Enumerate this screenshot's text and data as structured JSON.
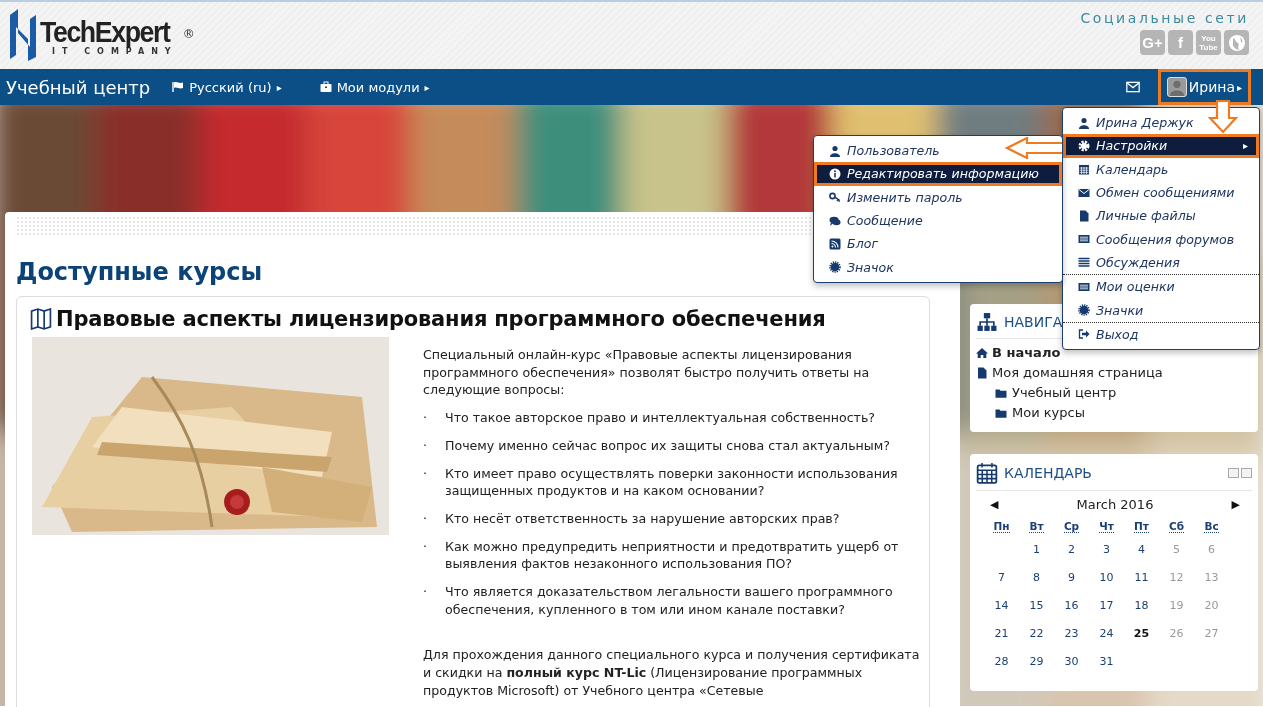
{
  "header": {
    "logo": {
      "name": "TechExpert",
      "mark": "®",
      "tagline": "IT COMPANY"
    },
    "social_title": "Социальные сети",
    "social": [
      {
        "kind": "text",
        "lines": [
          "G+"
        ]
      },
      {
        "kind": "text",
        "lines": [
          "f"
        ]
      },
      {
        "kind": "text",
        "lines": [
          "You",
          "Tube"
        ]
      },
      {
        "kind": "globe"
      }
    ]
  },
  "navbar": {
    "brand": "Учебный центр",
    "menus": [
      {
        "label": "Русский (ru)",
        "caret": "▸"
      },
      {
        "label": "Мои модули",
        "caret": "▸"
      }
    ],
    "user": {
      "name": "Ирина",
      "caret": "▸",
      "highlighted": true
    }
  },
  "user_menu": {
    "sections": [
      [
        {
          "label": "Ирина Держук",
          "selected": false
        },
        {
          "label": "Настройки",
          "selected": true,
          "submenu_caret": "▸"
        },
        {
          "label": "Календарь",
          "selected": false
        },
        {
          "label": "Обмен сообщениями",
          "selected": false
        },
        {
          "label": "Личные файлы",
          "selected": false
        },
        {
          "label": "Сообщения форумов",
          "selected": false
        },
        {
          "label": "Обсуждения",
          "selected": false
        }
      ],
      [
        {
          "label": "Мои оценки",
          "selected": false
        },
        {
          "label": "Значки",
          "selected": false
        }
      ],
      [
        {
          "label": "Выход",
          "selected": false
        }
      ]
    ]
  },
  "settings_submenu": [
    {
      "label": "Пользователь",
      "selected": false
    },
    {
      "label": "Редактировать информацию",
      "selected": true
    },
    {
      "label": "Изменить пароль",
      "selected": false
    },
    {
      "label": "Сообщение",
      "selected": false
    },
    {
      "label": "Блог",
      "selected": false
    },
    {
      "label": "Значок",
      "selected": false
    }
  ],
  "main": {
    "heading": "Доступные курсы",
    "course": {
      "title": "Правовые аспекты лицензирования программного обеспечения",
      "intro": "Специальный онлайн-курс «Правовые аспекты лицензирования программного обеспечения» позволят быстро получить ответы на следующие вопросы:",
      "questions": [
        {
          "marker": "·",
          "text": "Что такое авторское право и интеллектуальная собственность?"
        },
        {
          "marker": "·",
          "text": "Почему именно сейчас вопрос их защиты снова стал актуальным?"
        },
        {
          "marker": "·",
          "text": "Кто имеет право осуществлять поверки законности использования защищенных продуктов и на каком основании?"
        },
        {
          "marker": "·",
          "text": "Кто несёт ответственность за нарушение авторских прав?"
        },
        {
          "marker": "·",
          "text": "Как можно предупредить неприятности и предотвратить ущерб от выявления фактов незаконного использования ПО?"
        },
        {
          "marker": "·",
          "text": "Что является доказательством легальности вашего программного обеспечения, купленного в том или ином канале поставки?"
        }
      ],
      "outro": "Для прохождения данного специального курса и получения сертификата и скидки на **полный курс NT-Lic** (Лицензирование программных продуктов Microsoft) от Учебного центра «Сетевые"
    }
  },
  "navigation": {
    "title": "НАВИГА",
    "items": [
      {
        "label": "В начало",
        "bold": true
      },
      {
        "label": "Моя домашняя страница",
        "bold": false,
        "children": [
          {
            "label": "Учебный центр",
            "bold": false
          },
          {
            "label": "Мои курсы",
            "bold": false
          }
        ]
      }
    ]
  },
  "calendar": {
    "title": "КАЛЕНДАРЬ",
    "prev": "◀",
    "month": "March 2016",
    "next": "▶",
    "weekdays": [
      "Пн",
      "Вт",
      "Ср",
      "Чт",
      "Пт",
      "Сб",
      "Вс"
    ],
    "days": [
      {
        "kind": "blank"
      },
      {
        "kind": "day",
        "text": "1",
        "weekend": false,
        "today": false
      },
      {
        "kind": "day",
        "text": "2",
        "weekend": false,
        "today": false
      },
      {
        "kind": "day",
        "text": "3",
        "weekend": false,
        "today": false
      },
      {
        "kind": "day",
        "text": "4",
        "weekend": false,
        "today": false
      },
      {
        "kind": "day",
        "text": "5",
        "weekend": true,
        "today": false
      },
      {
        "kind": "day",
        "text": "6",
        "weekend": true,
        "today": false
      },
      {
        "kind": "day",
        "text": "7",
        "weekend": false,
        "today": false
      },
      {
        "kind": "day",
        "text": "8",
        "weekend": false,
        "today": false
      },
      {
        "kind": "day",
        "text": "9",
        "weekend": false,
        "today": false
      },
      {
        "kind": "day",
        "text": "10",
        "weekend": false,
        "today": false
      },
      {
        "kind": "day",
        "text": "11",
        "weekend": false,
        "today": false
      },
      {
        "kind": "day",
        "text": "12",
        "weekend": true,
        "today": false
      },
      {
        "kind": "day",
        "text": "13",
        "weekend": true,
        "today": false
      },
      {
        "kind": "day",
        "text": "14",
        "weekend": false,
        "today": false
      },
      {
        "kind": "day",
        "text": "15",
        "weekend": false,
        "today": false
      },
      {
        "kind": "day",
        "text": "16",
        "weekend": false,
        "today": false
      },
      {
        "kind": "day",
        "text": "17",
        "weekend": false,
        "today": false
      },
      {
        "kind": "day",
        "text": "18",
        "weekend": false,
        "today": false
      },
      {
        "kind": "day",
        "text": "19",
        "weekend": true,
        "today": false
      },
      {
        "kind": "day",
        "text": "20",
        "weekend": true,
        "today": false
      },
      {
        "kind": "day",
        "text": "21",
        "weekend": false,
        "today": false
      },
      {
        "kind": "day",
        "text": "22",
        "weekend": false,
        "today": false
      },
      {
        "kind": "day",
        "text": "23",
        "weekend": false,
        "today": false
      },
      {
        "kind": "day",
        "text": "24",
        "weekend": false,
        "today": false
      },
      {
        "kind": "day",
        "text": "25",
        "weekend": false,
        "today": true
      },
      {
        "kind": "day",
        "text": "26",
        "weekend": true,
        "today": false
      },
      {
        "kind": "day",
        "text": "27",
        "weekend": true,
        "today": false
      },
      {
        "kind": "day",
        "text": "28",
        "weekend": false,
        "today": false
      },
      {
        "kind": "day",
        "text": "29",
        "weekend": false,
        "today": false
      },
      {
        "kind": "day",
        "text": "30",
        "weekend": false,
        "today": false
      },
      {
        "kind": "day",
        "text": "31",
        "weekend": false,
        "today": false
      }
    ]
  }
}
